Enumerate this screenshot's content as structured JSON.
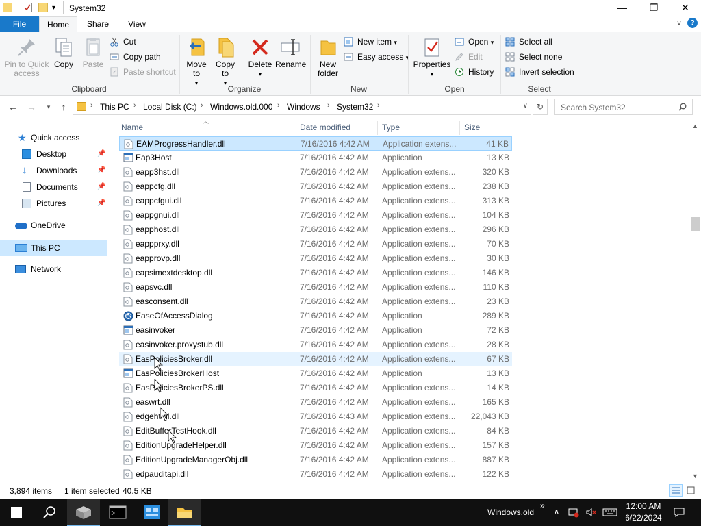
{
  "window": {
    "title": "System32",
    "minimize": "—",
    "maximize": "❐",
    "close": "✕"
  },
  "tabs": [
    "File",
    "Home",
    "Share",
    "View"
  ],
  "ribbon": {
    "clipboard": {
      "label": "Clipboard",
      "pin": "Pin to Quick access",
      "copy": "Copy",
      "paste": "Paste",
      "cut": "Cut",
      "copy_path": "Copy path",
      "paste_shortcut": "Paste shortcut"
    },
    "organize": {
      "label": "Organize",
      "move_to": "Move to",
      "copy_to": "Copy to",
      "delete": "Delete",
      "rename": "Rename"
    },
    "new": {
      "label": "New",
      "new_folder": "New folder",
      "new_item": "New item",
      "easy_access": "Easy access"
    },
    "open": {
      "label": "Open",
      "properties": "Properties",
      "open": "Open",
      "edit": "Edit",
      "history": "History"
    },
    "select": {
      "label": "Select",
      "select_all": "Select all",
      "select_none": "Select none",
      "invert": "Invert selection"
    }
  },
  "address": {
    "crumbs": [
      "This PC",
      "Local Disk (C:)",
      "Windows.old.000",
      "Windows",
      "System32"
    ],
    "search_placeholder": "Search System32"
  },
  "nav": {
    "quick_access": "Quick access",
    "desktop": "Desktop",
    "downloads": "Downloads",
    "documents": "Documents",
    "pictures": "Pictures",
    "onedrive": "OneDrive",
    "this_pc": "This PC",
    "network": "Network"
  },
  "columns": {
    "name": "Name",
    "date": "Date modified",
    "type": "Type",
    "size": "Size"
  },
  "files": [
    {
      "name": "EAMProgressHandler.dll",
      "date": "7/16/2016 4:42 AM",
      "type": "Application extens...",
      "size": "41 KB",
      "icon": "dll"
    },
    {
      "name": "Eap3Host",
      "date": "7/16/2016 4:42 AM",
      "type": "Application",
      "size": "13 KB",
      "icon": "app"
    },
    {
      "name": "eapp3hst.dll",
      "date": "7/16/2016 4:42 AM",
      "type": "Application extens...",
      "size": "320 KB",
      "icon": "dll"
    },
    {
      "name": "eappcfg.dll",
      "date": "7/16/2016 4:42 AM",
      "type": "Application extens...",
      "size": "238 KB",
      "icon": "dll"
    },
    {
      "name": "eappcfgui.dll",
      "date": "7/16/2016 4:42 AM",
      "type": "Application extens...",
      "size": "313 KB",
      "icon": "dll"
    },
    {
      "name": "eappgnui.dll",
      "date": "7/16/2016 4:42 AM",
      "type": "Application extens...",
      "size": "104 KB",
      "icon": "dll"
    },
    {
      "name": "eapphost.dll",
      "date": "7/16/2016 4:42 AM",
      "type": "Application extens...",
      "size": "296 KB",
      "icon": "dll"
    },
    {
      "name": "eappprxy.dll",
      "date": "7/16/2016 4:42 AM",
      "type": "Application extens...",
      "size": "70 KB",
      "icon": "dll"
    },
    {
      "name": "eapprovp.dll",
      "date": "7/16/2016 4:42 AM",
      "type": "Application extens...",
      "size": "30 KB",
      "icon": "dll"
    },
    {
      "name": "eapsimextdesktop.dll",
      "date": "7/16/2016 4:42 AM",
      "type": "Application extens...",
      "size": "146 KB",
      "icon": "dll"
    },
    {
      "name": "eapsvc.dll",
      "date": "7/16/2016 4:42 AM",
      "type": "Application extens...",
      "size": "110 KB",
      "icon": "dll"
    },
    {
      "name": "easconsent.dll",
      "date": "7/16/2016 4:42 AM",
      "type": "Application extens...",
      "size": "23 KB",
      "icon": "dll"
    },
    {
      "name": "EaseOfAccessDialog",
      "date": "7/16/2016 4:42 AM",
      "type": "Application",
      "size": "289 KB",
      "icon": "ease"
    },
    {
      "name": "easinvoker",
      "date": "7/16/2016 4:42 AM",
      "type": "Application",
      "size": "72 KB",
      "icon": "app"
    },
    {
      "name": "easinvoker.proxystub.dll",
      "date": "7/16/2016 4:42 AM",
      "type": "Application extens...",
      "size": "28 KB",
      "icon": "dll"
    },
    {
      "name": "EasPoliciesBroker.dll",
      "date": "7/16/2016 4:42 AM",
      "type": "Application extens...",
      "size": "67 KB",
      "icon": "dll"
    },
    {
      "name": "EasPoliciesBrokerHost",
      "date": "7/16/2016 4:42 AM",
      "type": "Application",
      "size": "13 KB",
      "icon": "app"
    },
    {
      "name": "EasPoliciesBrokerPS.dll",
      "date": "7/16/2016 4:42 AM",
      "type": "Application extens...",
      "size": "14 KB",
      "icon": "dll"
    },
    {
      "name": "easwrt.dll",
      "date": "7/16/2016 4:42 AM",
      "type": "Application extens...",
      "size": "165 KB",
      "icon": "dll"
    },
    {
      "name": "edgehtml.dll",
      "date": "7/16/2016 4:43 AM",
      "type": "Application extens...",
      "size": "22,043 KB",
      "icon": "dll"
    },
    {
      "name": "EditBufferTestHook.dll",
      "date": "7/16/2016 4:42 AM",
      "type": "Application extens...",
      "size": "84 KB",
      "icon": "dll"
    },
    {
      "name": "EditionUpgradeHelper.dll",
      "date": "7/16/2016 4:42 AM",
      "type": "Application extens...",
      "size": "157 KB",
      "icon": "dll"
    },
    {
      "name": "EditionUpgradeManagerObj.dll",
      "date": "7/16/2016 4:42 AM",
      "type": "Application extens...",
      "size": "887 KB",
      "icon": "dll"
    },
    {
      "name": "edpauditapi.dll",
      "date": "7/16/2016 4:42 AM",
      "type": "Application extens...",
      "size": "122 KB",
      "icon": "dll"
    }
  ],
  "status": {
    "items": "3,894 items",
    "selected": "1 item selected",
    "selected_size": "40.5 KB"
  },
  "taskbar": {
    "toolbar_label": "Windows.old",
    "toolbar_chevron": "»",
    "time": "12:00 AM",
    "date": "6/22/2024"
  },
  "colors": {
    "accent": "#1979ca",
    "selection": "#cce8ff",
    "taskbar": "#101010"
  }
}
